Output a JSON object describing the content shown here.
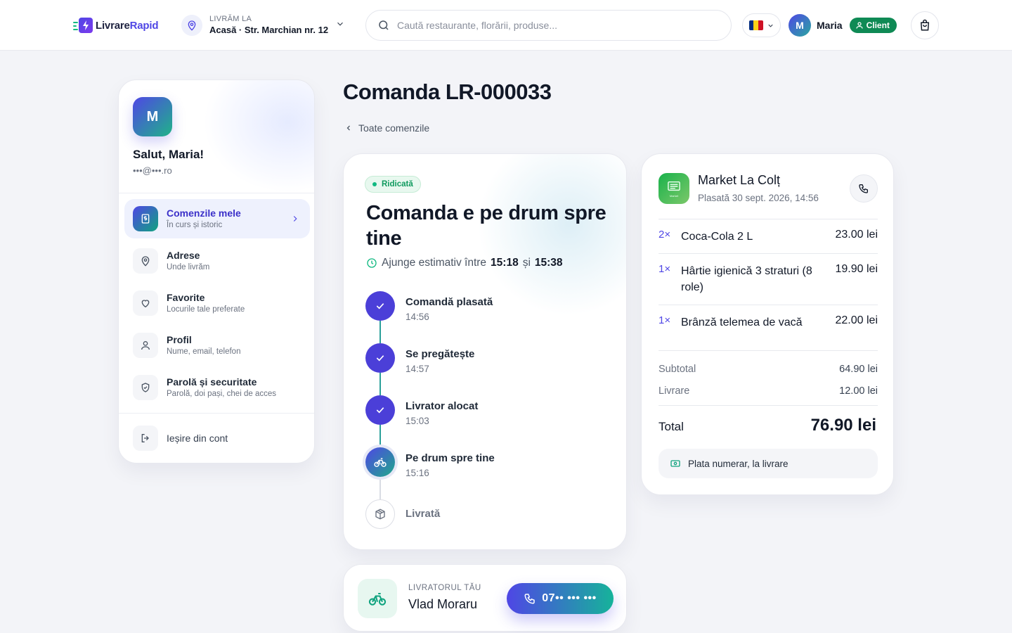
{
  "header": {
    "logo": {
      "part1": "Livrare",
      "part2": "Rapid"
    },
    "deliver": {
      "label": "LIVRĂM LA",
      "address": "Acasă · Str. Marchian nr. 12"
    },
    "search": {
      "placeholder": "Caută restaurante, florării, produse..."
    },
    "language": {
      "flag": "RO"
    },
    "user": {
      "initial": "M",
      "name": "Maria",
      "role": "Client"
    }
  },
  "sidebar": {
    "avatar_initial": "M",
    "greeting": "Salut, Maria!",
    "email": "•••@•••.ro",
    "items": [
      {
        "title": "Comenzile mele",
        "subtitle": "În curs și istoric",
        "icon": "receipt-icon",
        "active": true
      },
      {
        "title": "Adrese",
        "subtitle": "Unde livrăm",
        "icon": "map-pin-icon",
        "active": false
      },
      {
        "title": "Favorite",
        "subtitle": "Locurile tale preferate",
        "icon": "heart-icon",
        "active": false
      },
      {
        "title": "Profil",
        "subtitle": "Nume, email, telefon",
        "icon": "user-icon",
        "active": false
      },
      {
        "title": "Parolă și securitate",
        "subtitle": "Parolă, doi pași, chei de acces",
        "icon": "shield-icon",
        "active": false
      }
    ],
    "logout": "Ieșire din cont"
  },
  "main": {
    "title": "Comanda LR-000033",
    "back_link": "Toate comenzile"
  },
  "status": {
    "badge": "Ridicată",
    "title": "Comanda e pe drum spre tine",
    "eta_prefix": "Ajunge estimativ între",
    "eta_from": "15:18",
    "eta_and": "și",
    "eta_to": "15:38",
    "steps": [
      {
        "label": "Comandă plasată",
        "time": "14:56",
        "state": "done"
      },
      {
        "label": "Se pregătește",
        "time": "14:57",
        "state": "done"
      },
      {
        "label": "Livrator alocat",
        "time": "15:03",
        "state": "done"
      },
      {
        "label": "Pe drum spre tine",
        "time": "15:16",
        "state": "current"
      },
      {
        "label": "Livrată",
        "time": "",
        "state": "pending"
      }
    ]
  },
  "courier": {
    "label": "LIVRATORUL TĂU",
    "name": "Vlad Moraru",
    "phone": "07•• ••• •••"
  },
  "order": {
    "store_name": "Market La Colț",
    "store_logo_text": "Market",
    "placed": "Plasată 30 sept. 2026, 14:56",
    "items": [
      {
        "qty": "2×",
        "name": "Coca-Cola 2 L",
        "price": "23.00 lei"
      },
      {
        "qty": "1×",
        "name": "Hârtie igienică 3 straturi (8 role)",
        "price": "19.90 lei"
      },
      {
        "qty": "1×",
        "name": "Brânză telemea de vacă",
        "price": "22.00 lei"
      }
    ],
    "subtotal_label": "Subtotal",
    "subtotal": "64.90 lei",
    "delivery_label": "Livrare",
    "delivery": "12.00 lei",
    "total_label": "Total",
    "total": "76.90 lei",
    "payment": "Plata numerar, la livrare"
  },
  "colors": {
    "accent": "#4f46e5",
    "success": "#10b981",
    "client_badge": "#0f8a55"
  }
}
